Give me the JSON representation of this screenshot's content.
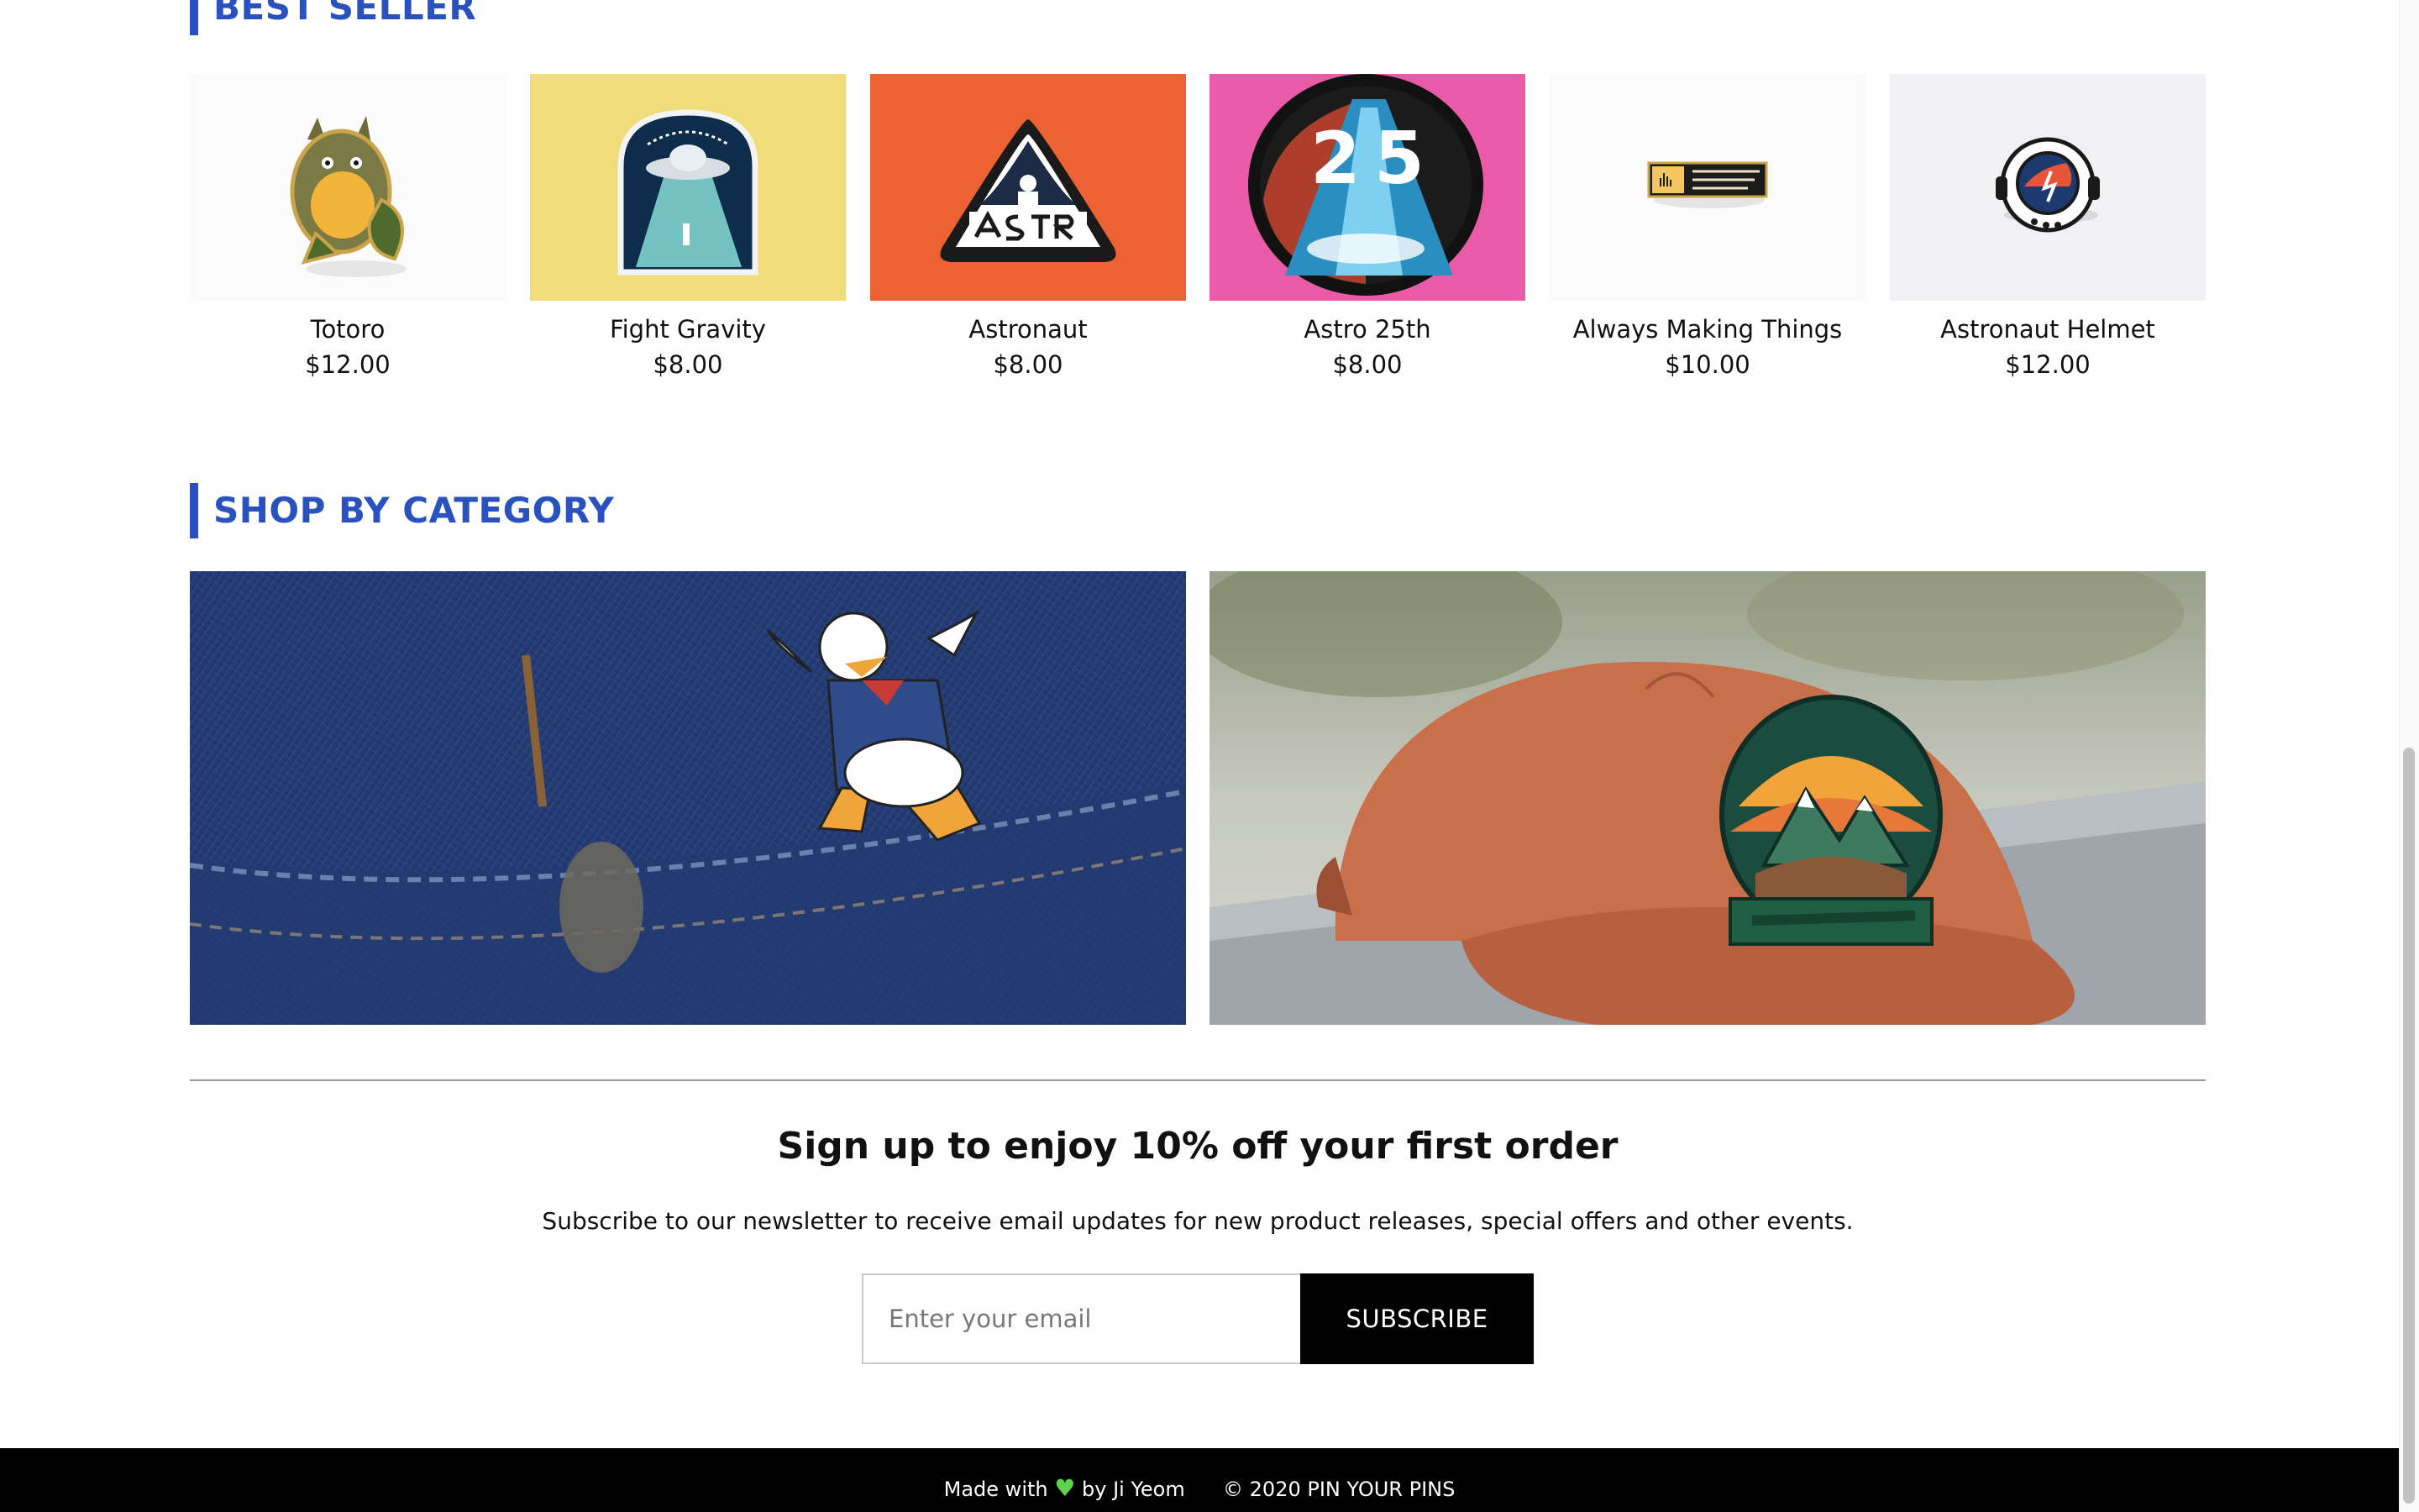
{
  "best_seller": {
    "title": "BEST SELLER",
    "products": [
      {
        "name": "Totoro",
        "price": "$12.00"
      },
      {
        "name": "Fight Gravity",
        "price": "$8.00"
      },
      {
        "name": "Astronaut",
        "price": "$8.00"
      },
      {
        "name": "Astro 25th",
        "price": "$8.00"
      },
      {
        "name": "Always Making Things",
        "price": "$10.00"
      },
      {
        "name": "Astronaut Helmet",
        "price": "$12.00"
      }
    ]
  },
  "category": {
    "title": "SHOP BY CATEGORY"
  },
  "newsletter": {
    "heading": "Sign up to enjoy 10% off your first order",
    "description": "Subscribe to our newsletter to receive email updates for new product releases, special offers and other events.",
    "email_placeholder": "Enter your email",
    "subscribe_label": "SUBSCRIBE"
  },
  "footer": {
    "made_with": "Made with",
    "by": "by Ji Yeom",
    "copyright": "© 2020 PIN YOUR PINS"
  },
  "colors": {
    "accent": "#2a52be",
    "heart": "#5ed34a"
  }
}
